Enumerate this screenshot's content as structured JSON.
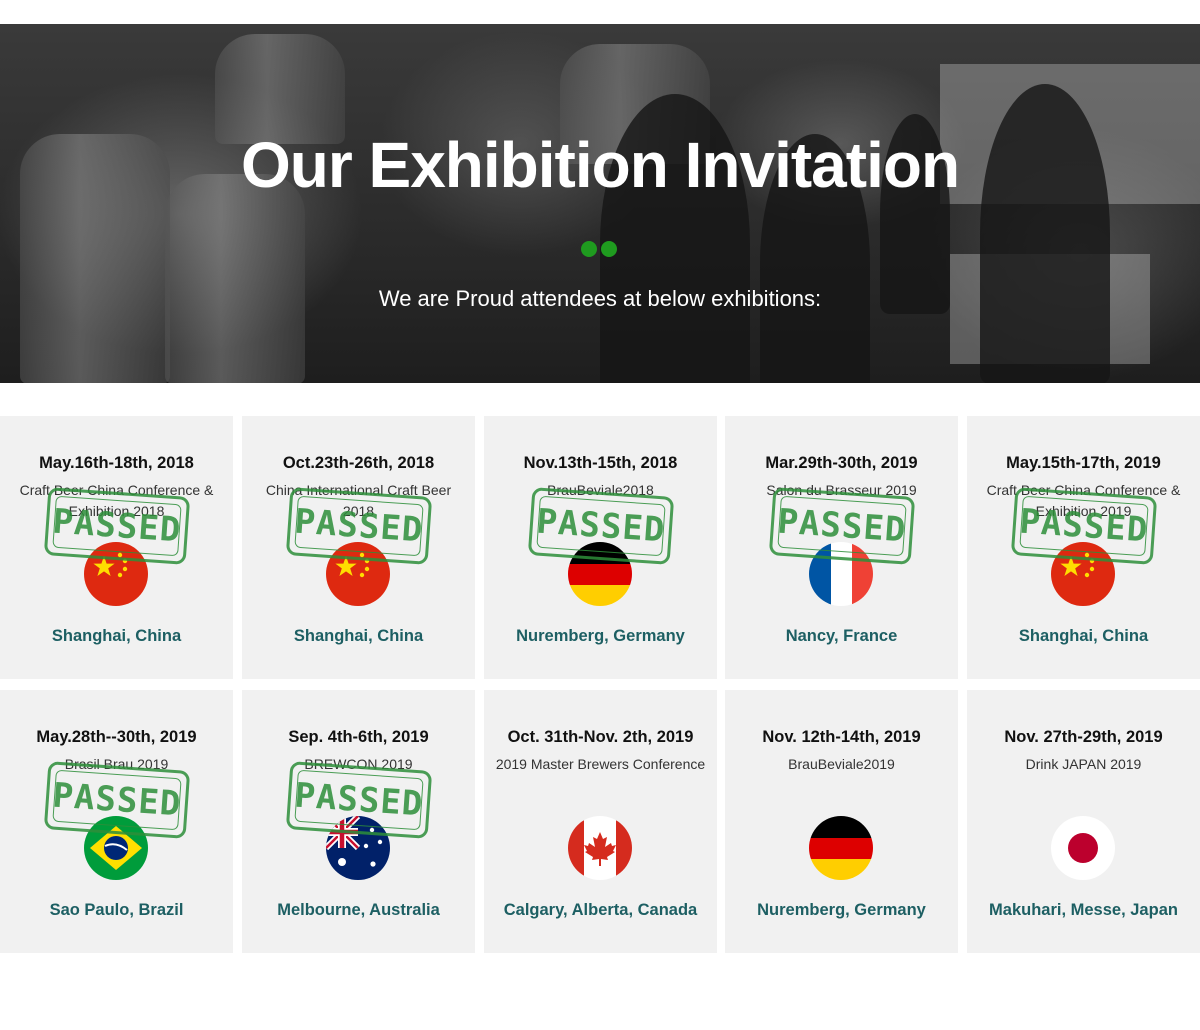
{
  "hero": {
    "title": "Our Exhibition Invitation",
    "subtitle": "We are Proud attendees at below exhibitions:"
  },
  "stamp_label": "PASSED",
  "colors": {
    "accent_green": "#1f9b1f",
    "location_teal": "#1d5f63",
    "card_bg": "#f1f1f1"
  },
  "exhibitions": [
    {
      "date": "May.16th-18th, 2018",
      "event": "Craft Beer China Conference & Exhibition 2018",
      "location": "Shanghai, China",
      "flag": "china-flag-icon",
      "passed": true
    },
    {
      "date": "Oct.23th-26th, 2018",
      "event": "China International Craft Beer 2018",
      "location": "Shanghai, China",
      "flag": "china-flag-icon",
      "passed": true
    },
    {
      "date": "Nov.13th-15th, 2018",
      "event": "BrauBeviale2018",
      "location": "Nuremberg, Germany",
      "flag": "germany-flag-icon",
      "passed": true
    },
    {
      "date": "Mar.29th-30th, 2019",
      "event": "Salon du Brasseur 2019",
      "location": "Nancy, France",
      "flag": "france-flag-icon",
      "passed": true
    },
    {
      "date": "May.15th-17th, 2019",
      "event": "Craft Beer China Conference & Exhibition 2019",
      "location": "Shanghai, China",
      "flag": "china-flag-icon",
      "passed": true
    },
    {
      "date": "May.28th--30th, 2019",
      "event": "Brasil Brau 2019",
      "location": "Sao Paulo, Brazil",
      "flag": "brazil-flag-icon",
      "passed": true
    },
    {
      "date": "Sep. 4th-6th, 2019",
      "event": "BREWCON 2019",
      "location": "Melbourne, Australia",
      "flag": "australia-flag-icon",
      "passed": true
    },
    {
      "date": "Oct. 31th-Nov. 2th, 2019",
      "event": "2019 Master Brewers Conference",
      "location": "Calgary, Alberta, Canada",
      "flag": "canada-flag-icon",
      "passed": false
    },
    {
      "date": "Nov. 12th-14th, 2019",
      "event": "BrauBeviale2019",
      "location": "Nuremberg, Germany",
      "flag": "germany-flag-icon",
      "passed": false
    },
    {
      "date": "Nov. 27th-29th, 2019",
      "event": "Drink JAPAN 2019",
      "location": "Makuhari, Messe, Japan",
      "flag": "japan-flag-icon",
      "passed": false
    }
  ]
}
